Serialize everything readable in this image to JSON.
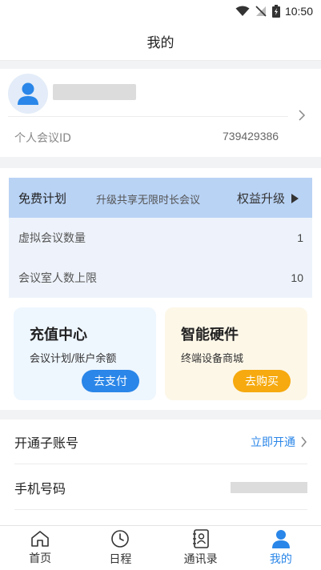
{
  "status_bar": {
    "time": "10:50"
  },
  "header": {
    "title": "我的"
  },
  "profile": {
    "meeting_id_label": "个人会议ID",
    "meeting_id_value": "739429386"
  },
  "plan": {
    "name": "免费计划",
    "description": "升级共享无限时长会议",
    "upgrade_label": "权益升级",
    "rows": [
      {
        "label": "虚拟会议数量",
        "value": "1"
      },
      {
        "label": "会议室人数上限",
        "value": "10"
      }
    ]
  },
  "cards": {
    "recharge": {
      "title": "充值中心",
      "subtitle": "会议计划/账户余额",
      "button": "去支付"
    },
    "hardware": {
      "title": "智能硬件",
      "subtitle": "终端设备商城",
      "button": "去购买"
    }
  },
  "settings": {
    "sub_account": {
      "label": "开通子账号",
      "action": "立即开通"
    },
    "phone": {
      "label": "手机号码"
    }
  },
  "tabs": [
    {
      "label": "首页",
      "icon": "home-icon"
    },
    {
      "label": "日程",
      "icon": "clock-icon"
    },
    {
      "label": "通讯录",
      "icon": "contacts-icon"
    },
    {
      "label": "我的",
      "icon": "person-icon",
      "active": true
    }
  ],
  "colors": {
    "accent": "#2a86e8",
    "plan_header": "#b9d3f5",
    "buy_button": "#f6aa0f"
  }
}
